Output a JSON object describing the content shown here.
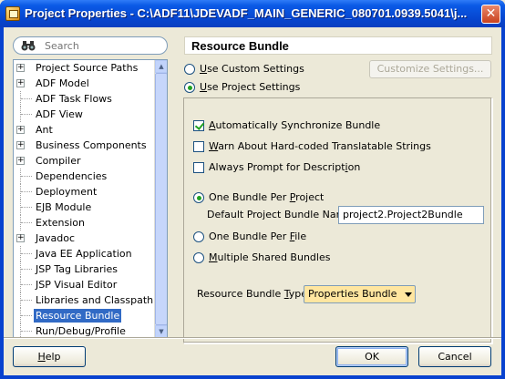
{
  "window": {
    "title": "Project Properties - C:\\ADF11\\JDEVADF_MAIN_GENERIC_080701.0939.5041\\j..."
  },
  "nav": {
    "search_placeholder": "Search",
    "items": [
      {
        "label": "Project Source Paths",
        "expandable": true
      },
      {
        "label": "ADF Model",
        "expandable": true
      },
      {
        "label": "ADF Task Flows",
        "expandable": false
      },
      {
        "label": "ADF View",
        "expandable": false
      },
      {
        "label": "Ant",
        "expandable": true
      },
      {
        "label": "Business Components",
        "expandable": true
      },
      {
        "label": "Compiler",
        "expandable": true
      },
      {
        "label": "Dependencies",
        "expandable": false
      },
      {
        "label": "Deployment",
        "expandable": false
      },
      {
        "label": "EJB Module",
        "expandable": false
      },
      {
        "label": "Extension",
        "expandable": false
      },
      {
        "label": "Javadoc",
        "expandable": true
      },
      {
        "label": "Java EE Application",
        "expandable": false
      },
      {
        "label": "JSP Tag Libraries",
        "expandable": false
      },
      {
        "label": "JSP Visual Editor",
        "expandable": false
      },
      {
        "label": "Libraries and Classpath",
        "expandable": false
      },
      {
        "label": "Resource Bundle",
        "expandable": false,
        "selected": true
      },
      {
        "label": "Run/Debug/Profile",
        "expandable": false
      }
    ]
  },
  "panel": {
    "title": "Resource Bundle",
    "use_custom_settings": "Use Custom Settings",
    "use_project_settings": "Use Project Settings",
    "customize_settings": "Customize Settings...",
    "auto_sync": "Automatically Synchronize Bundle",
    "warn_hardcoded": "Warn About Hard-coded Translatable Strings",
    "always_prompt": "Always Prompt for Description",
    "one_per_project": "One Bundle Per Project",
    "default_bundle_label": "Default Project Bundle Name:",
    "default_bundle_value": "project2.Project2Bundle",
    "one_per_file": "One Bundle Per File",
    "multiple_shared": "Multiple Shared Bundles",
    "bundle_type_label": "Resource Bundle Type:",
    "bundle_type_value": "Properties Bundle"
  },
  "buttons": {
    "help": "Help",
    "ok": "OK",
    "cancel": "Cancel"
  }
}
